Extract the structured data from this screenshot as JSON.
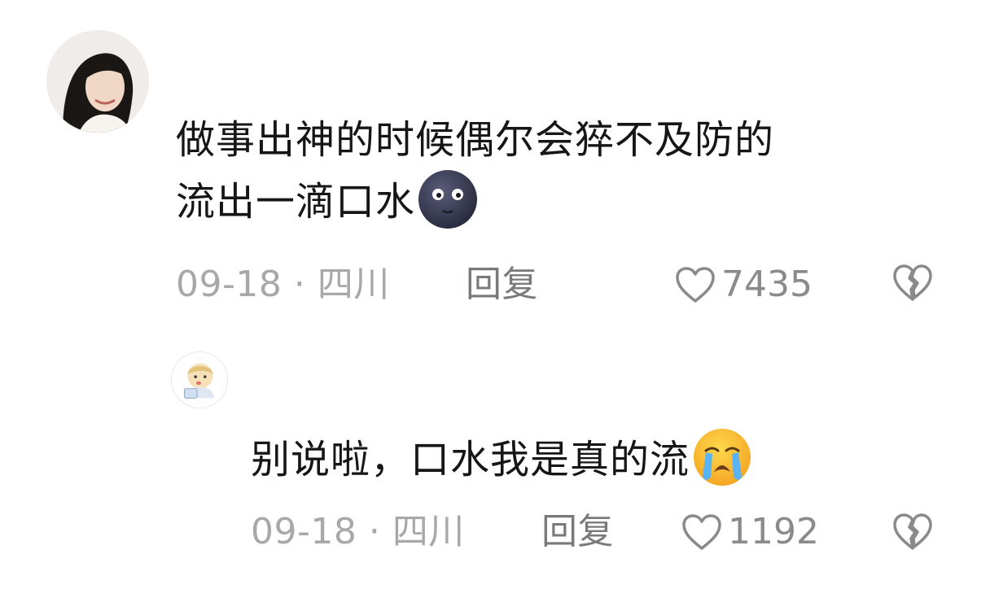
{
  "comments": [
    {
      "avatar": {
        "icon": "user-avatar-photo"
      },
      "text_lines": [
        "做事出神的时候偶尔会猝不及防的",
        "流出一滴口水"
      ],
      "emoji": "new-moon-face-emoji",
      "meta": "09-18 · 四川",
      "reply_label": "回复",
      "likes": "7435",
      "icons": {
        "like": "heart-outline-icon",
        "dislike": "broken-heart-icon"
      }
    },
    {
      "avatar": {
        "icon": "cartoon-avatar"
      },
      "text": "别说啦，口水我是真的流",
      "emoji": "loudly-crying-face-emoji",
      "meta": "09-18 · 四川",
      "reply_label": "回复",
      "likes": "1192",
      "icons": {
        "like": "heart-outline-icon",
        "dislike": "broken-heart-icon"
      }
    }
  ],
  "colors": {
    "text": "#161616",
    "meta": "#a8a8a8",
    "reply": "#7a7a7a",
    "icon": "#8a8a8a",
    "background": "#ffffff"
  }
}
